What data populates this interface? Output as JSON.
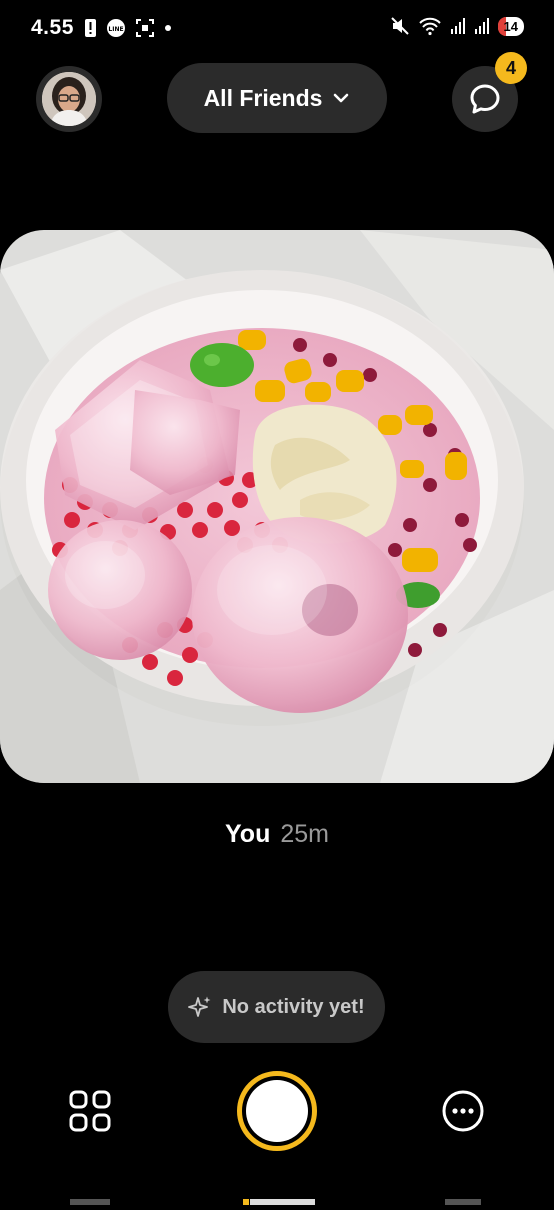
{
  "status_bar": {
    "time": "4.55",
    "left_icons": [
      "alert-icon",
      "line-app-icon",
      "screenshot-icon",
      "dot-icon"
    ],
    "right_icons": [
      "mute-icon",
      "wifi-icon",
      "signal-icon",
      "signal-icon"
    ],
    "battery": "14",
    "battery_color": "#e0403a"
  },
  "header": {
    "friends_label": "All Friends",
    "chat_badge": "4"
  },
  "post": {
    "author": "You",
    "time_ago": "25m"
  },
  "activity": {
    "label": "No activity yet!"
  },
  "colors": {
    "accent": "#f5b91d",
    "pill_bg": "#2b2b2b",
    "background": "#000000"
  }
}
